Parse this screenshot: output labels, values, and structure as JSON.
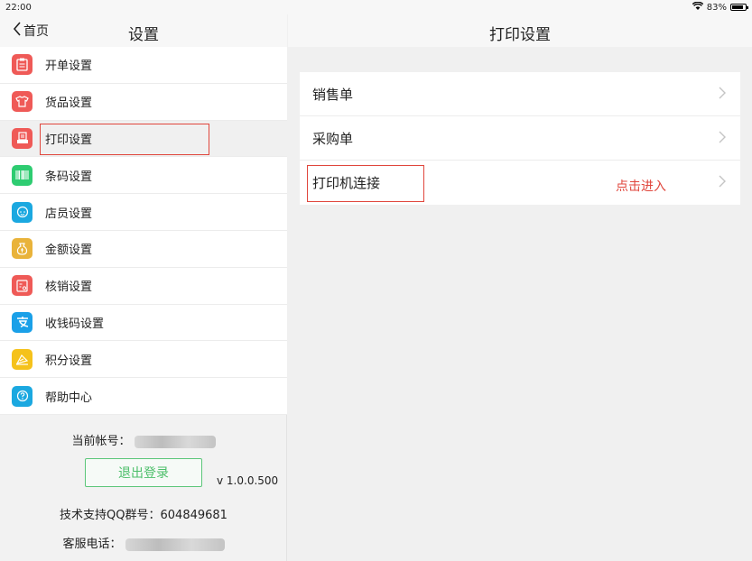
{
  "status": {
    "time": "22:00",
    "battery": "83%",
    "battery_level": 0.83
  },
  "left": {
    "back_label": "首页",
    "title": "设置",
    "menu": [
      {
        "label": "开单设置",
        "icon": "clipboard-icon",
        "color": "#ef5a57"
      },
      {
        "label": "货品设置",
        "icon": "tshirt-icon",
        "color": "#ef5a57"
      },
      {
        "label": "打印设置",
        "icon": "printer-icon",
        "color": "#ef5a57"
      },
      {
        "label": "条码设置",
        "icon": "barcode-icon",
        "color": "#2ecc71"
      },
      {
        "label": "店员设置",
        "icon": "staff-icon",
        "color": "#1ba8e0"
      },
      {
        "label": "金额设置",
        "icon": "money-bag-icon",
        "color": "#e9b33a"
      },
      {
        "label": "核销设置",
        "icon": "verify-icon",
        "color": "#ef5a57"
      },
      {
        "label": "收钱码设置",
        "icon": "alipay-icon",
        "color": "#1aa0e8"
      },
      {
        "label": "积分设置",
        "icon": "points-icon",
        "color": "#f5c21b"
      },
      {
        "label": "帮助中心",
        "icon": "help-icon",
        "color": "#1ba8e0"
      }
    ],
    "account_label": "当前帐号：",
    "logout_label": "退出登录",
    "version": "v 1.0.0.500",
    "support_text": "技术支持QQ群号：604849681",
    "service_label": "客服电话："
  },
  "right": {
    "title": "打印设置",
    "items": [
      {
        "label": "销售单"
      },
      {
        "label": "采购单"
      },
      {
        "label": "打印机连接"
      }
    ],
    "note": "点击进入"
  }
}
